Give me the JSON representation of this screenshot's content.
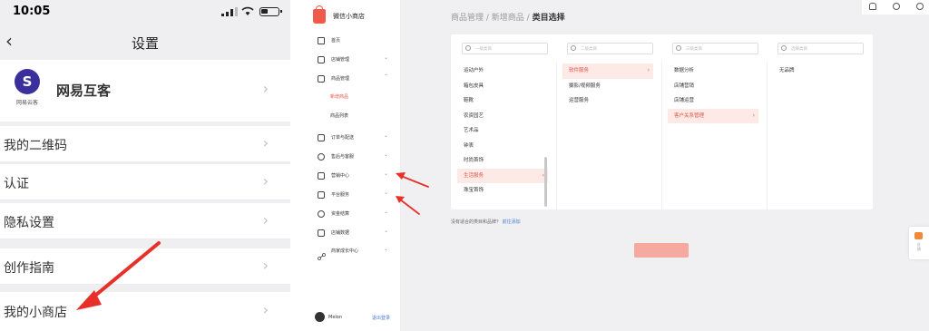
{
  "phone": {
    "status_time": "10:05",
    "nav_title": "设置",
    "profile": {
      "logo_subtext": "网易云客",
      "name": "网易互客"
    },
    "rows": [
      {
        "label": "我的二维码"
      },
      {
        "label": "认证"
      },
      {
        "label": "隐私设置"
      },
      {
        "label": "创作指南"
      },
      {
        "label": "我的小商店"
      }
    ]
  },
  "admin": {
    "brand": "微信小商店",
    "menu": [
      {
        "label": "首页",
        "has_arrow": false
      },
      {
        "label": "店铺管理",
        "has_arrow": true
      },
      {
        "label": "商品管理",
        "has_arrow": true
      },
      {
        "label": "新增商品",
        "sub": true,
        "active": true
      },
      {
        "label": "商品列表",
        "sub": true
      },
      {
        "label": "订单与配送",
        "has_arrow": true
      },
      {
        "label": "售后与客服",
        "has_arrow": true
      },
      {
        "label": "营销中心",
        "has_arrow": true
      },
      {
        "label": "平台服务",
        "has_arrow": true
      },
      {
        "label": "资金结算",
        "has_arrow": true
      },
      {
        "label": "店铺数据",
        "has_arrow": true
      },
      {
        "label": "商家成长中心",
        "has_arrow": true
      }
    ],
    "user": {
      "name": "Melon",
      "logout": "退出登录"
    },
    "breadcrumb": {
      "part1": "商品管理",
      "sep": " / ",
      "part2": "新增商品",
      "current": "类目选择"
    },
    "columns": [
      {
        "placeholder": "一级类目",
        "items": [
          {
            "label": "运动户外"
          },
          {
            "label": "箱包皮具"
          },
          {
            "label": "鞋靴"
          },
          {
            "label": "农资园艺"
          },
          {
            "label": "艺术品"
          },
          {
            "label": "钟表"
          },
          {
            "label": "时尚首饰"
          },
          {
            "label": "生活服务",
            "selected": true,
            "arrow": true
          },
          {
            "label": "珠宝首饰"
          }
        ]
      },
      {
        "placeholder": "二级类目",
        "items": [
          {
            "label": "软件服务",
            "selected": true,
            "arrow": true
          },
          {
            "label": "摄影/视频服务"
          },
          {
            "label": "运营服务"
          }
        ]
      },
      {
        "placeholder": "三级类目",
        "items": [
          {
            "label": "数据分析"
          },
          {
            "label": "店铺营销"
          },
          {
            "label": "店铺运营"
          },
          {
            "label": "客户关系管理",
            "selected": true,
            "arrow": true
          }
        ]
      },
      {
        "placeholder": "选择类目",
        "items": [
          {
            "label": "无品牌"
          }
        ]
      }
    ],
    "hint_text": "没有适合的类目和品牌?",
    "hint_link": "前往添加",
    "feedback_label": "反馈"
  },
  "colors": {
    "accent": "#e05545",
    "selected_bg": "#fde9e6",
    "button_disabled": "#f6a99f",
    "annotation_arrow": "#e8302a"
  }
}
